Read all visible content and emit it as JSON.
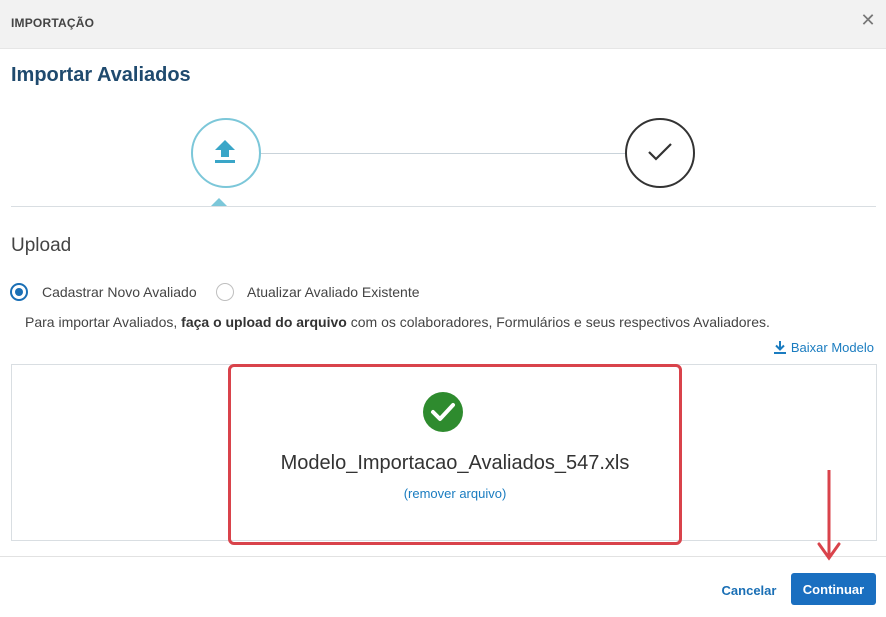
{
  "modal": {
    "header_title": "IMPORTAÇÃO",
    "close_icon": "close-icon",
    "page_title": "Importar Avaliados"
  },
  "stepper": {
    "steps": [
      {
        "icon": "upload-icon",
        "state": "active"
      },
      {
        "icon": "check-icon",
        "state": "pending"
      }
    ]
  },
  "upload": {
    "section_title": "Upload",
    "options": [
      {
        "label": "Cadastrar Novo Avaliado",
        "selected": true
      },
      {
        "label": "Atualizar Avaliado Existente",
        "selected": false
      }
    ],
    "instructions_prefix": "Para importar Avaliados, ",
    "instructions_bold": "faça o upload do arquivo",
    "instructions_suffix": " com os colaboradores, Formulários e seus respectivos Avaliadores.",
    "download_label": "Baixar Modelo",
    "file_name": "Modelo_Importacao_Avaliados_547.xls",
    "remove_label": "(remover arquivo)"
  },
  "footer": {
    "cancel_label": "Cancelar",
    "continue_label": "Continuar"
  },
  "colors": {
    "accent": "#1a6fc0",
    "success": "#2e8b2e",
    "annotation": "#d9434b",
    "step_active": "#7cc7d9"
  }
}
